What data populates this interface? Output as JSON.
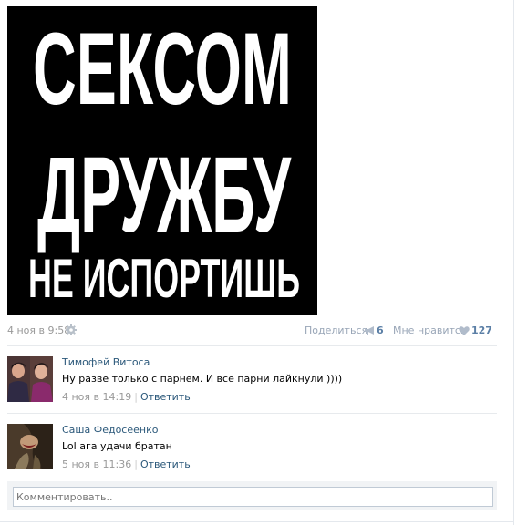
{
  "post": {
    "image": {
      "line1": "СЕКСОМ",
      "line2": "ДРУЖБУ",
      "line3": "НЕ ИСПОРТИШЬ"
    },
    "date": "4 ноя в 9:58",
    "share_label": "Поделиться",
    "share_count": "6",
    "like_label": "Мне нравится",
    "like_count": "127"
  },
  "comments": [
    {
      "author": "Тимофей Витоса",
      "text": "Ну разве только с парнем. И все парни лайкнули ))))",
      "date": "4 ноя в 14:19",
      "reply": "Ответить"
    },
    {
      "author": "Саша Федосеенко",
      "text": "Lol ага удачи братан",
      "date": "5 ноя в 11:36",
      "reply": "Ответить"
    }
  ],
  "comment_box": {
    "placeholder": "Комментировать.."
  },
  "colors": {
    "link": "#2b587a",
    "meta": "#999999",
    "count": "#5b7fa6"
  },
  "icons": [
    "gear-icon",
    "megaphone-icon",
    "heart-icon"
  ]
}
